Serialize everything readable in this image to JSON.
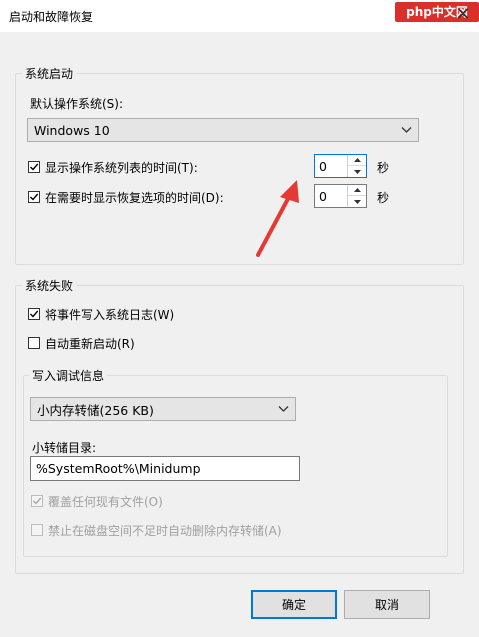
{
  "window": {
    "title": "启动和故障恢复",
    "close_glyph": "✕",
    "watermark": "php中文网"
  },
  "startup": {
    "group_label": "系统启动",
    "default_os_label": "默认操作系统(S):",
    "default_os_value": "Windows 10",
    "show_os_list": {
      "label": "显示操作系统列表的时间(T):",
      "checked": true,
      "value": "0",
      "unit": "秒"
    },
    "show_recovery": {
      "label": "在需要时显示恢复选项的时间(D):",
      "checked": true,
      "value": "0",
      "unit": "秒"
    }
  },
  "failure": {
    "group_label": "系统失败",
    "write_event_log": {
      "label": "将事件写入系统日志(W)",
      "checked": true
    },
    "auto_restart": {
      "label": "自动重新启动(R)",
      "checked": false
    },
    "debug": {
      "group_label": "写入调试信息",
      "dump_type": "小内存转储(256 KB)",
      "dump_dir_label": "小转储目录:",
      "dump_dir_value": "%SystemRoot%\\Minidump",
      "overwrite": {
        "label": "覆盖任何现有文件(O)",
        "checked": true,
        "disabled": true
      },
      "disable_auto_delete": {
        "label": "禁止在磁盘空间不足时自动删除内存转储(A)",
        "checked": false,
        "disabled": true
      }
    }
  },
  "buttons": {
    "ok": "确定",
    "cancel": "取消"
  },
  "colors": {
    "accent": "#0078d7",
    "annotation_arrow": "#e53935",
    "watermark_bg": "#d9302b"
  }
}
